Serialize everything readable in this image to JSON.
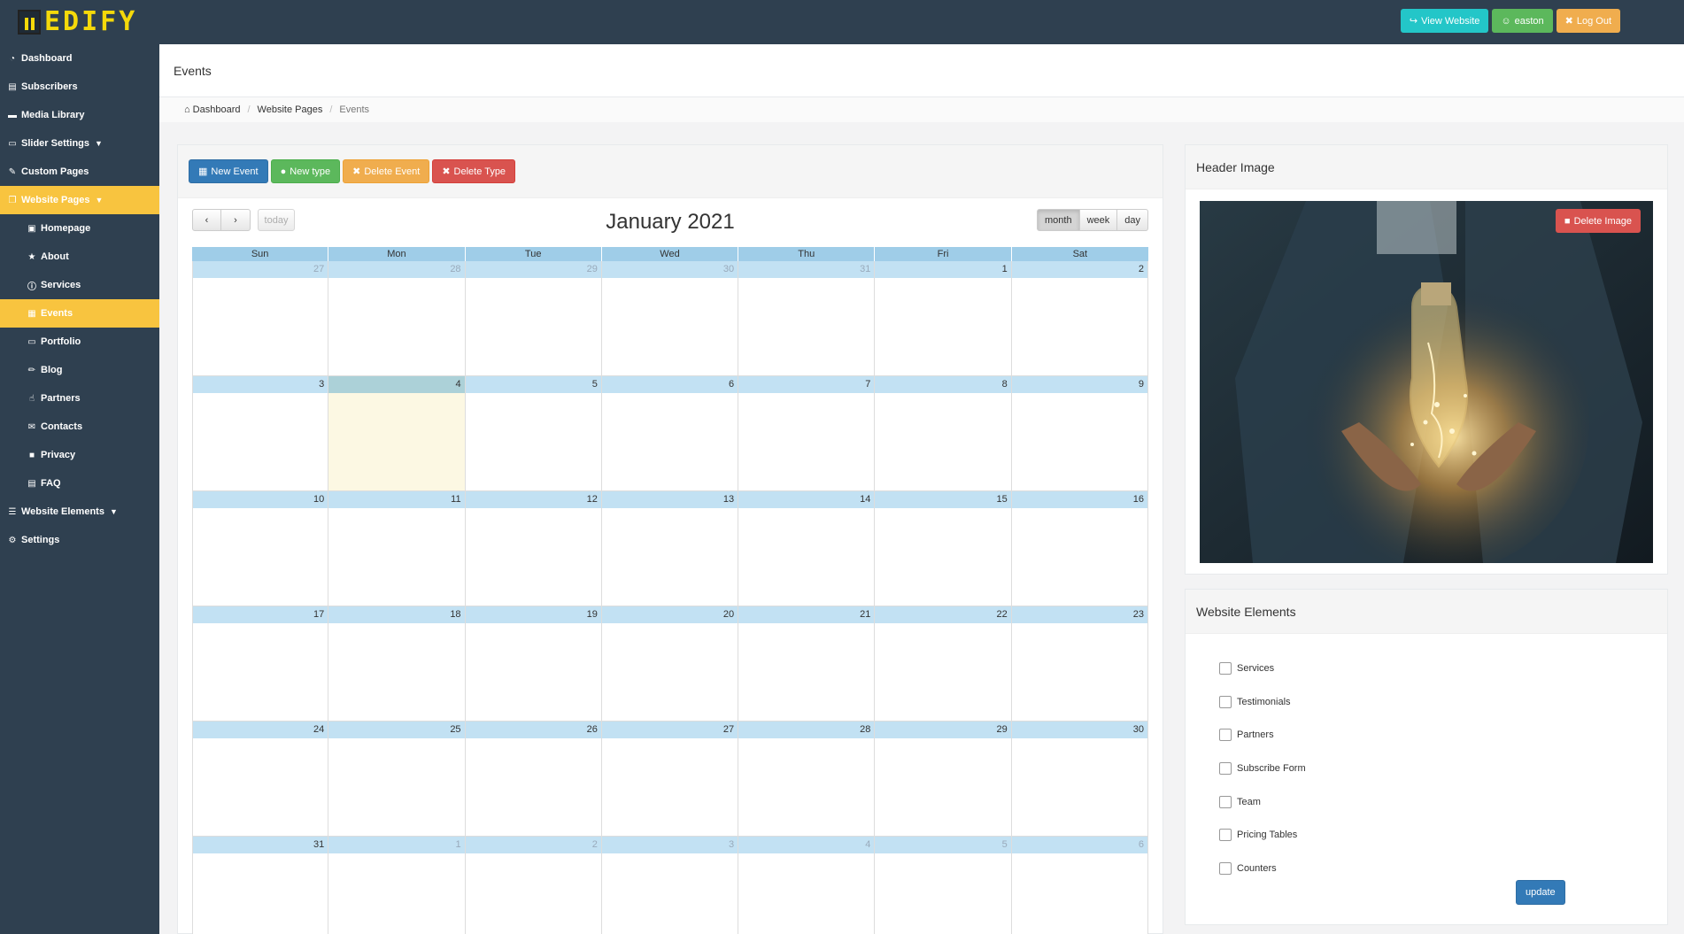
{
  "brand": {
    "logo_text": "EDIFY"
  },
  "topbar": {
    "view_website": "View Website",
    "user": "easton",
    "logout": "Log Out"
  },
  "sidebar": {
    "items": [
      {
        "label": "Dashboard",
        "icon": "dashboard-icon"
      },
      {
        "label": "Subscribers",
        "icon": "newspaper-icon"
      },
      {
        "label": "Media Library",
        "icon": "folder-icon"
      },
      {
        "label": "Slider Settings",
        "icon": "desktop-icon"
      },
      {
        "label": "Custom Pages",
        "icon": "edit-icon"
      },
      {
        "label": "Website Pages",
        "icon": "copy-icon"
      },
      {
        "label": "Homepage",
        "icon": "square-edit-icon"
      },
      {
        "label": "About",
        "icon": "star-icon"
      },
      {
        "label": "Services",
        "icon": "info-icon"
      },
      {
        "label": "Events",
        "icon": "calendar-icon"
      },
      {
        "label": "Portfolio",
        "icon": "laptop-icon"
      },
      {
        "label": "Blog",
        "icon": "pencil-icon"
      },
      {
        "label": "Partners",
        "icon": "thumbs-up-icon"
      },
      {
        "label": "Contacts",
        "icon": "envelope-icon"
      },
      {
        "label": "Privacy",
        "icon": "lock-icon"
      },
      {
        "label": "FAQ",
        "icon": "id-card-icon"
      },
      {
        "label": "Website Elements",
        "icon": "bars-icon"
      },
      {
        "label": "Settings",
        "icon": "cogs-icon"
      }
    ]
  },
  "page": {
    "title": "Events"
  },
  "breadcrumb": {
    "home": "Dashboard",
    "section": "Website Pages",
    "current": "Events"
  },
  "actions": {
    "new_event": "New Event",
    "new_type": "New type",
    "delete_event": "Delete Event",
    "delete_type": "Delete Type"
  },
  "calendar": {
    "title": "January 2021",
    "today_label": "today",
    "views": [
      "month",
      "week",
      "day"
    ],
    "active_view": "month",
    "weekdays": [
      "Sun",
      "Mon",
      "Tue",
      "Wed",
      "Thu",
      "Fri",
      "Sat"
    ],
    "weeks": [
      [
        "27",
        "28",
        "29",
        "30",
        "31",
        "1",
        "2"
      ],
      [
        "3",
        "4",
        "5",
        "6",
        "7",
        "8",
        "9"
      ],
      [
        "10",
        "11",
        "12",
        "13",
        "14",
        "15",
        "16"
      ],
      [
        "17",
        "18",
        "19",
        "20",
        "21",
        "22",
        "23"
      ],
      [
        "24",
        "25",
        "26",
        "27",
        "28",
        "29",
        "30"
      ],
      [
        "31",
        "1",
        "2",
        "3",
        "4",
        "5",
        "6"
      ]
    ]
  },
  "header_image": {
    "title": "Header Image",
    "delete_label": "Delete Image"
  },
  "website_elements": {
    "title": "Website Elements",
    "items": [
      "Services",
      "Testimonials",
      "Partners",
      "Subscribe Form",
      "Team",
      "Pricing Tables",
      "Counters"
    ],
    "update_label": "update"
  },
  "colors": {
    "topbar": "#2f4050",
    "active_nav": "#f8c43f",
    "accent_yellow": "#f5d90a",
    "day_header": "#c2e1f3",
    "today_bg": "#fcf8e3"
  }
}
